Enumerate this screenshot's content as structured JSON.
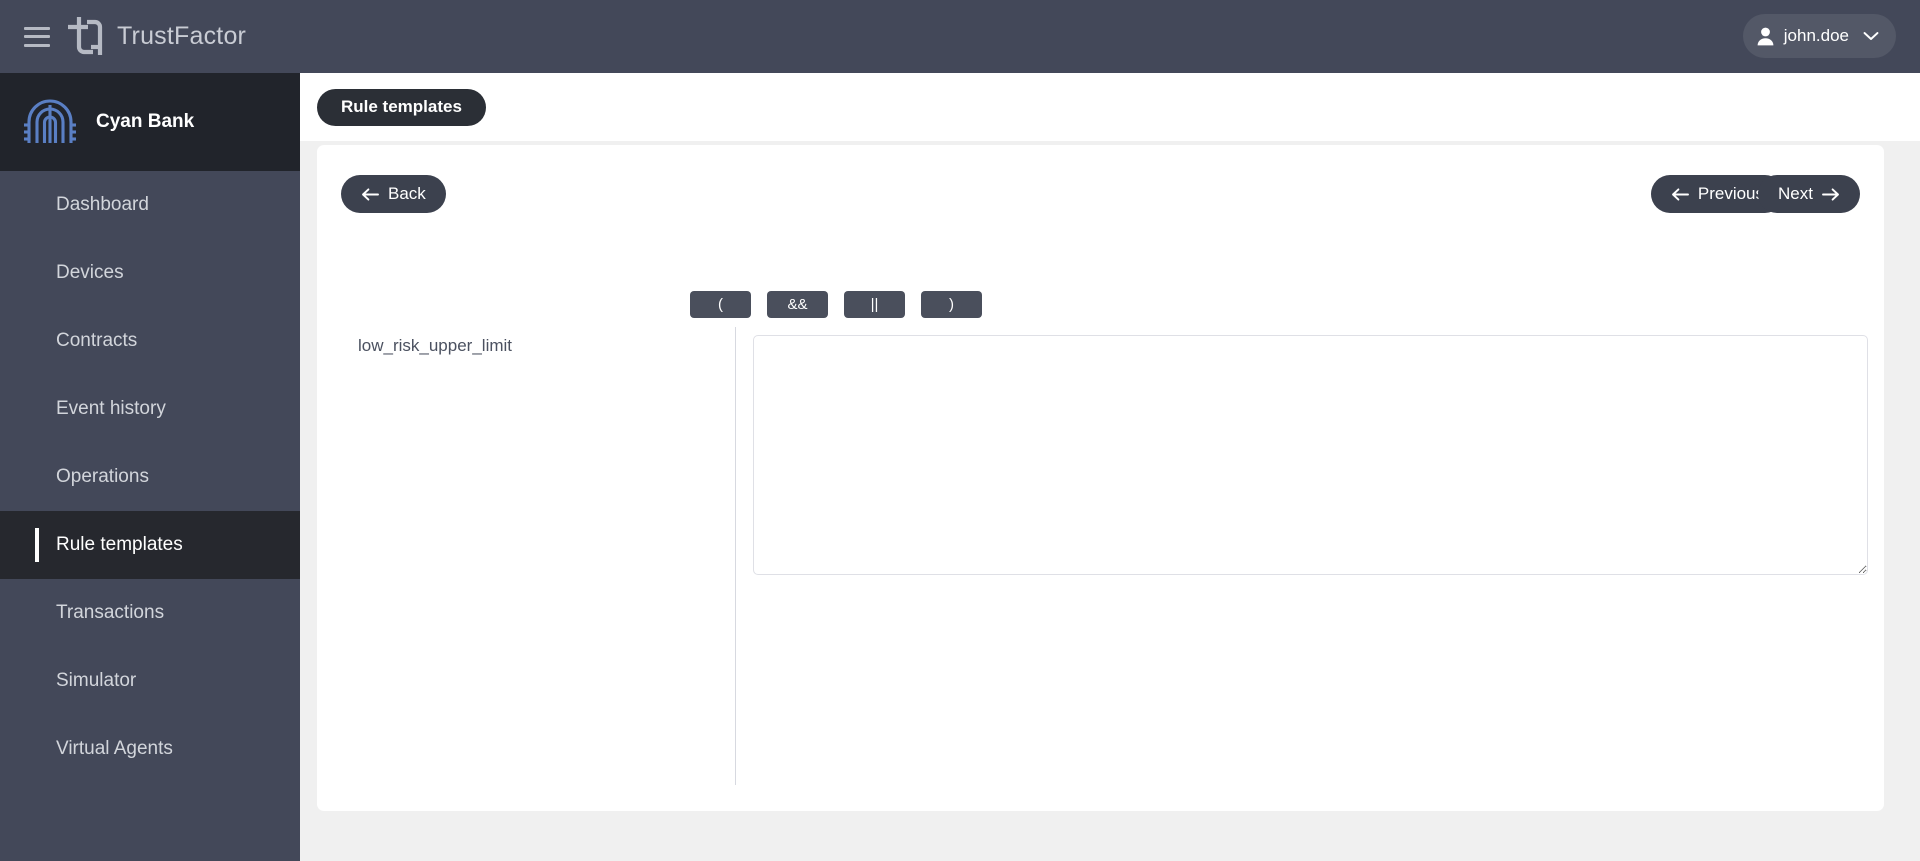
{
  "topbar": {
    "menu_icon": "hamburger-menu-icon",
    "logo_icon": "trustfactor-logo-icon",
    "app_name": "TrustFactor",
    "user": {
      "avatar_icon": "person-icon",
      "name": "john.doe",
      "chevron_icon": "chevron-down-icon"
    }
  },
  "sidebar": {
    "org": {
      "logo_icon": "cyan-bank-logo-icon",
      "name": "Cyan Bank"
    },
    "items": [
      {
        "label": "Dashboard",
        "active": false
      },
      {
        "label": "Devices",
        "active": false
      },
      {
        "label": "Contracts",
        "active": false
      },
      {
        "label": "Event history",
        "active": false
      },
      {
        "label": "Operations",
        "active": false
      },
      {
        "label": "Rule templates",
        "active": true
      },
      {
        "label": "Transactions",
        "active": false
      },
      {
        "label": "Simulator",
        "active": false
      },
      {
        "label": "Virtual Agents",
        "active": false
      }
    ]
  },
  "header": {
    "title": "Rule templates"
  },
  "toolbar": {
    "back_label": "Back",
    "back_icon": "arrow-left-icon",
    "previous_label": "Previous",
    "previous_icon": "arrow-left-icon",
    "next_label": "Next",
    "next_icon": "arrow-right-icon"
  },
  "operators": [
    {
      "label": "(",
      "name": "open-paren"
    },
    {
      "label": "&&",
      "name": "logical-and"
    },
    {
      "label": "||",
      "name": "logical-or"
    },
    {
      "label": ")",
      "name": "close-paren"
    }
  ],
  "form": {
    "field_label": "low_risk_upper_limit",
    "expression_value": "",
    "expression_placeholder": ""
  },
  "colors": {
    "topbar_bg": "#434859",
    "sidebar_bg": "#434859",
    "sidebar_active_bg": "#26282e",
    "org_bg": "#21242b",
    "pill_bg": "#3c414e",
    "page_pill_bg": "#2b2f36",
    "operator_bg": "#4a4f5c",
    "canvas_bg": "#f0f0f0",
    "card_bg": "#ffffff",
    "brand_blue": "#5a7fc4"
  }
}
